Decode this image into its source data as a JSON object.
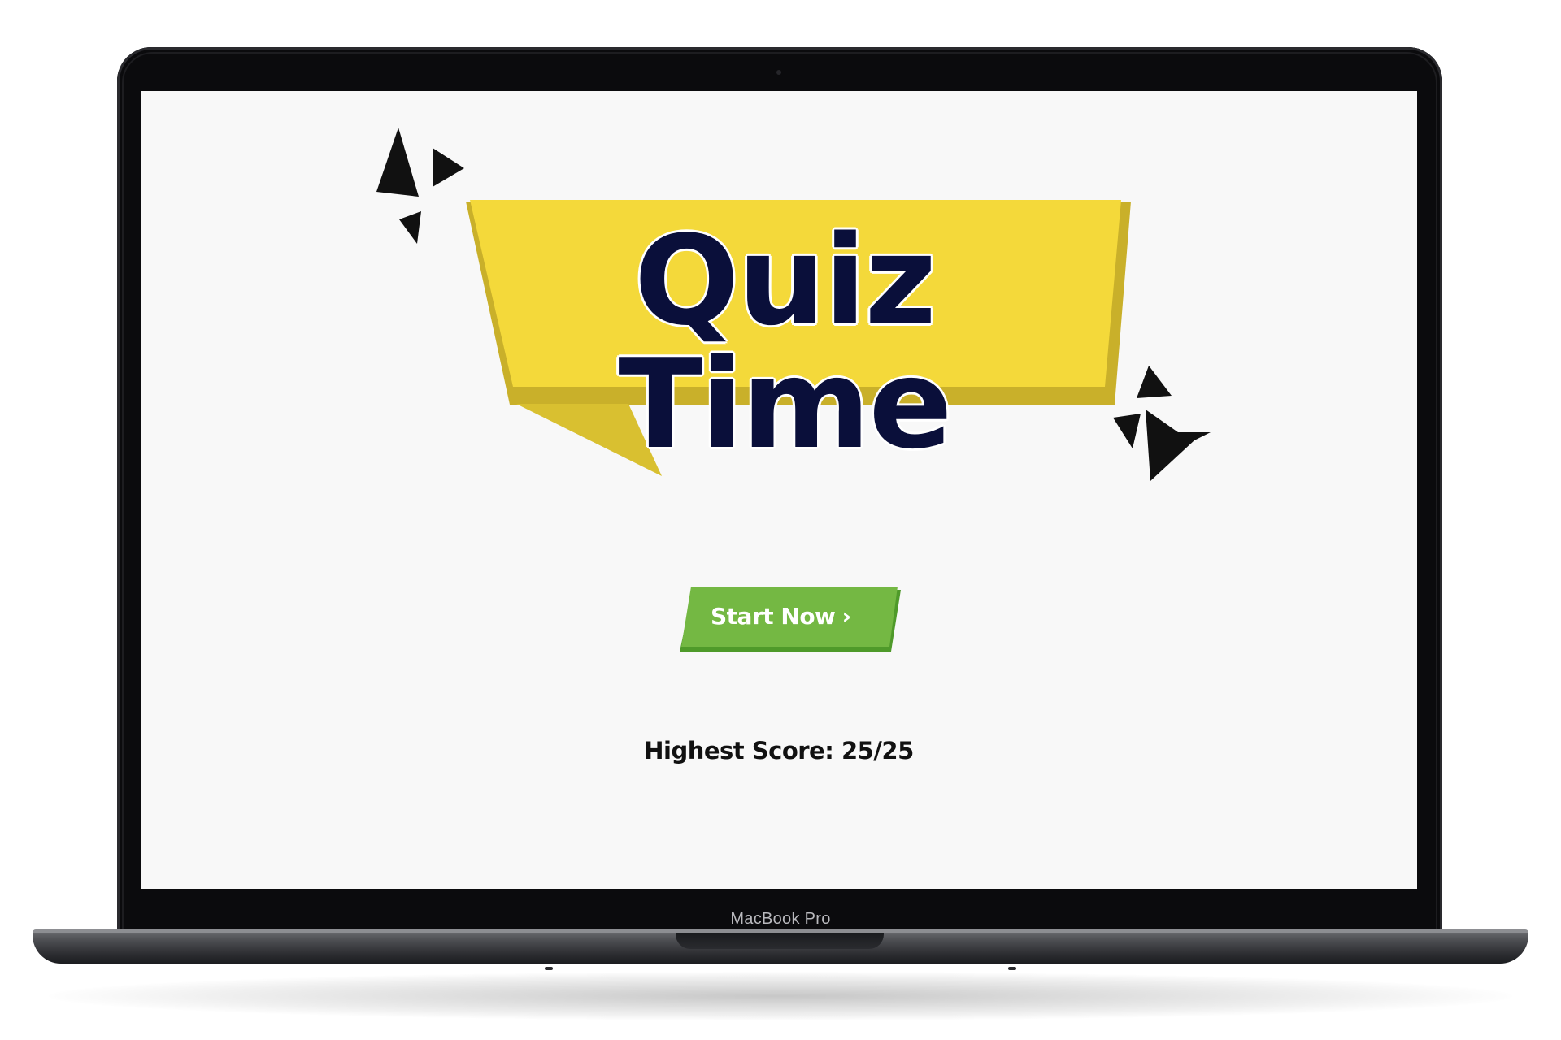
{
  "screen": {
    "title": "Quiz Time",
    "start_button_label": "Start Now",
    "start_button_icon": "chevron-right-icon",
    "score_label": "Highest Score:",
    "score_value": "25/25"
  },
  "device": {
    "label": "MacBook Pro"
  },
  "colors": {
    "banner_yellow": "#f4d93a",
    "banner_shadow": "#c9b02a",
    "title_navy": "#0a0f3a",
    "button_green": "#74b843",
    "button_shadow": "#4f9a2a",
    "screen_bg": "#f8f8f8"
  }
}
